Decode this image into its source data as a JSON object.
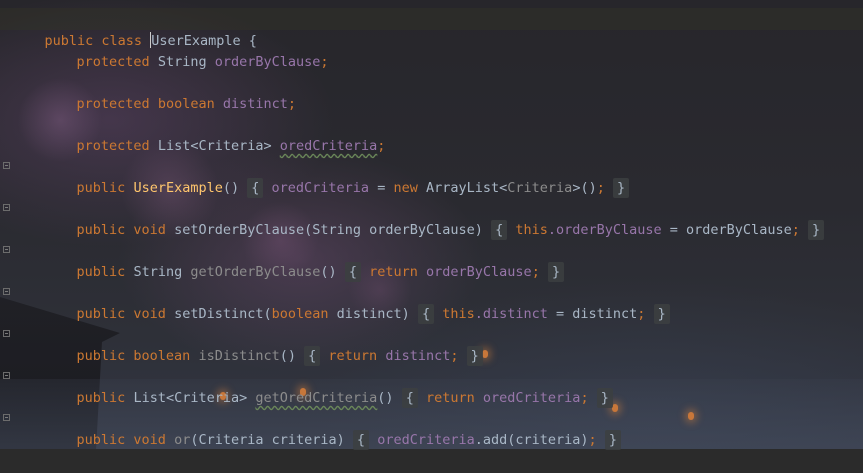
{
  "editor": {
    "language": "java",
    "colors": {
      "background": "#2b2b2b",
      "keyword": "#cc7832",
      "field": "#9876aa",
      "method_decl": "#ffc66d",
      "text": "#a9b7c6"
    },
    "lines": {
      "l1": {
        "kw": "public class",
        "name": "UserExample",
        "brace": "{"
      },
      "l2": {
        "kw": "protected",
        "type": "String",
        "field": "orderByClause",
        "end": ";"
      },
      "l3": {
        "kw": "protected",
        "type": "boolean",
        "field": "distinct",
        "end": ";"
      },
      "l4": {
        "kw": "protected",
        "type": "List<Criteria>",
        "field": "oredCriteria",
        "end": ";"
      },
      "l5": {
        "kw": "public",
        "name": "UserExample",
        "args": "()",
        "fold_open": "{",
        "field": "oredCriteria",
        "eq": " = ",
        "new": "new",
        "rest": "ArrayList<",
        "generic": "Criteria",
        "close": ">()",
        "semi": ";",
        "fold_close": "}"
      },
      "l6": {
        "kw": "public void",
        "name": "setOrderByClause",
        "args": "(String orderByClause)",
        "fold_open": "{",
        "this": "this",
        "field": ".orderByClause",
        "rest": " = orderByClause",
        "semi": ";",
        "fold_close": "}"
      },
      "l7": {
        "kw": "public",
        "type": "String",
        "name": "getOrderByClause",
        "args": "()",
        "fold_open": "{",
        "ret": "return",
        "field": "orderByClause",
        "semi": ";",
        "fold_close": "}"
      },
      "l8": {
        "kw": "public void",
        "name": "setDistinct",
        "args_open": "(",
        "arg_kw": "boolean",
        "args_rest": " distinct)",
        "fold_open": "{",
        "this": "this",
        "field": ".distinct",
        "rest": " = distinct",
        "semi": ";",
        "fold_close": "}"
      },
      "l9": {
        "kw": "public boolean",
        "name": "isDistinct",
        "args": "()",
        "fold_open": "{",
        "ret": "return",
        "field": "distinct",
        "semi": ";",
        "fold_close": "}"
      },
      "l10": {
        "kw": "public",
        "type": "List<Criteria>",
        "name": "getOredCriteria",
        "args": "()",
        "fold_open": "{",
        "ret": "return",
        "field": "oredCriteria",
        "semi": ";",
        "fold_close": "}"
      },
      "l11": {
        "kw": "public void",
        "name": "or",
        "args": "(Criteria criteria)",
        "fold_open": "{",
        "field": "oredCriteria",
        "rest": ".add(criteria)",
        "semi": ";",
        "fold_close": "}"
      }
    }
  }
}
